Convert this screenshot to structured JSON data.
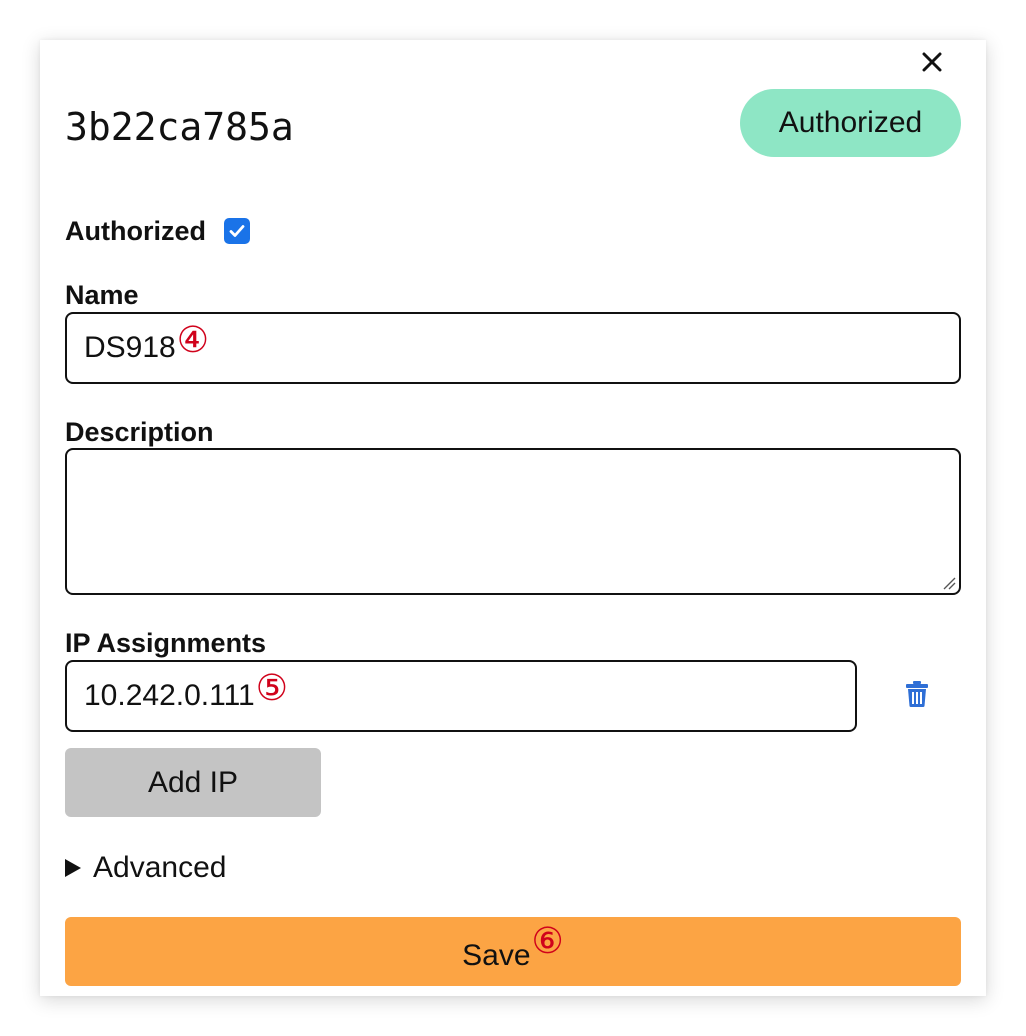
{
  "dialog": {
    "node_id": "3b22ca785a",
    "status_badge": "Authorized",
    "status_color": "#8ee6c5",
    "close_icon": "close-icon"
  },
  "form": {
    "authorized_label": "Authorized",
    "authorized_checked": true,
    "name_label": "Name",
    "name_value": "DS918",
    "name_marker": "④",
    "description_label": "Description",
    "description_value": "",
    "ip_label": "IP Assignments",
    "ip_value": "10.242.0.111",
    "ip_marker": "⑤",
    "delete_icon": "trash-icon",
    "add_ip_label": "Add IP",
    "advanced_label": "Advanced",
    "save_label": "Save",
    "save_marker": "⑥",
    "save_color": "#fca444",
    "add_ip_color": "#c4c4c4",
    "accent_color": "#1a73e8",
    "marker_color": "#d0021b"
  }
}
